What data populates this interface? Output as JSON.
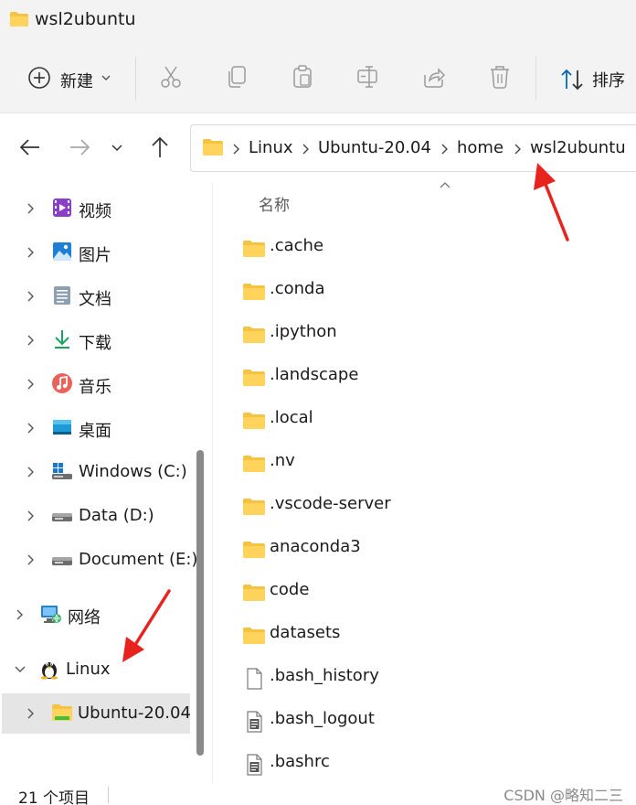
{
  "window": {
    "title": "wsl2ubuntu"
  },
  "commandbar": {
    "new_label": "新建",
    "sort_label": "排序"
  },
  "address": {
    "crumbs": [
      "Linux",
      "Ubuntu-20.04",
      "home",
      "wsl2ubuntu"
    ]
  },
  "navpane": {
    "items": [
      {
        "label": "视频",
        "icon": "video-library-icon"
      },
      {
        "label": "图片",
        "icon": "pictures-library-icon"
      },
      {
        "label": "文档",
        "icon": "documents-library-icon"
      },
      {
        "label": "下载",
        "icon": "downloads-icon"
      },
      {
        "label": "音乐",
        "icon": "music-library-icon"
      },
      {
        "label": "桌面",
        "icon": "desktop-icon"
      },
      {
        "label": "Windows (C:)",
        "icon": "windows-drive-icon"
      },
      {
        "label": "Data (D:)",
        "icon": "drive-icon"
      },
      {
        "label": "Document (E:)",
        "icon": "drive-icon"
      },
      {
        "label": "网络",
        "icon": "network-icon"
      },
      {
        "label": "Linux",
        "icon": "linux-penguin-icon"
      },
      {
        "label": "Ubuntu-20.04",
        "icon": "folder-icon"
      }
    ]
  },
  "filelist": {
    "column_name": "名称",
    "files": [
      {
        "name": ".cache",
        "type": "folder"
      },
      {
        "name": ".conda",
        "type": "folder"
      },
      {
        "name": ".ipython",
        "type": "folder"
      },
      {
        "name": ".landscape",
        "type": "folder"
      },
      {
        "name": ".local",
        "type": "folder"
      },
      {
        "name": ".nv",
        "type": "folder"
      },
      {
        "name": ".vscode-server",
        "type": "folder"
      },
      {
        "name": "anaconda3",
        "type": "folder"
      },
      {
        "name": "code",
        "type": "folder"
      },
      {
        "name": "datasets",
        "type": "folder"
      },
      {
        "name": ".bash_history",
        "type": "file"
      },
      {
        "name": ".bash_logout",
        "type": "text-file"
      },
      {
        "name": ".bashrc",
        "type": "text-file"
      }
    ]
  },
  "status": {
    "item_count": "21 个项目",
    "watermark": "CSDN @略知二三"
  },
  "colors": {
    "folder": "#f5c342",
    "accent": "#0067c0",
    "arrow": "#e8231e"
  }
}
